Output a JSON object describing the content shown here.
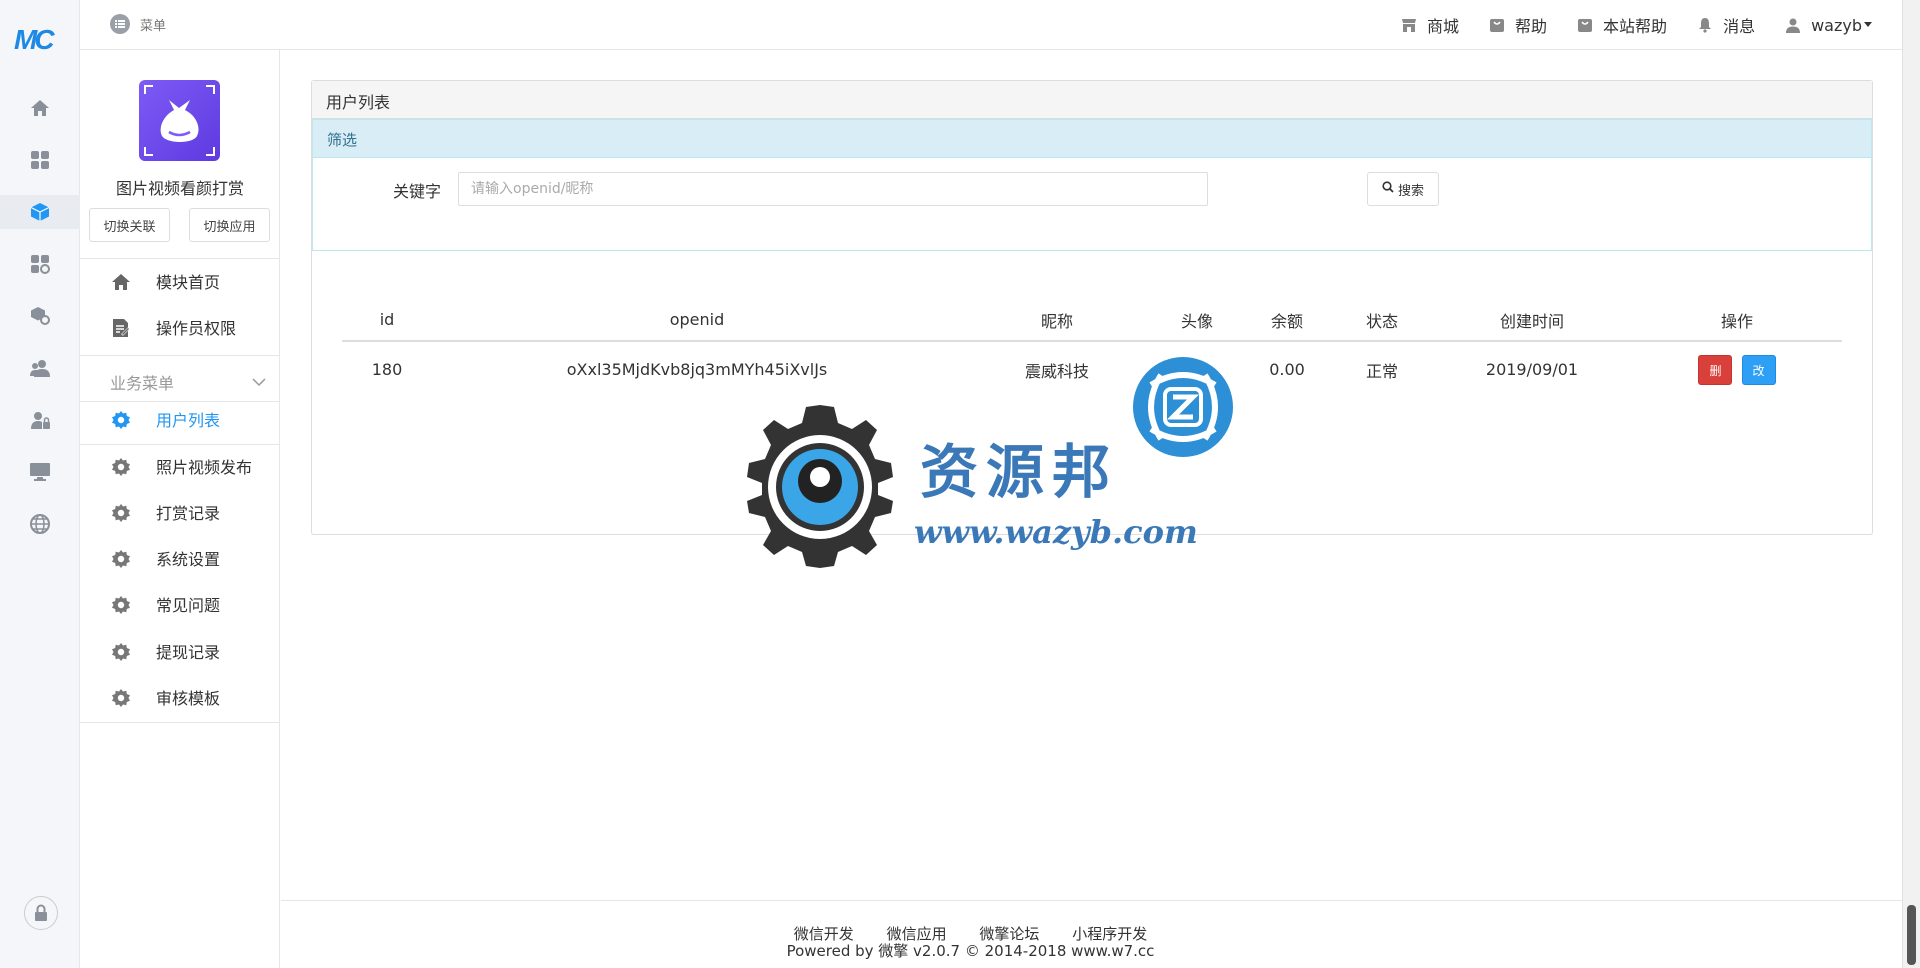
{
  "rail": {
    "logo": "MC",
    "items": [
      "home-icon",
      "apps-grid-icon",
      "module-cube-icon",
      "app-settings-icon",
      "cube-settings-icon",
      "users-icon",
      "user-lock-icon",
      "monitor-icon",
      "globe-icon"
    ],
    "active_index": 2,
    "bottom": "lock-icon"
  },
  "topbar": {
    "menu_label": "菜单",
    "nav": [
      {
        "icon": "store-icon",
        "label": "商城"
      },
      {
        "icon": "help-bag-icon",
        "label": "帮助"
      },
      {
        "icon": "site-help-icon",
        "label": "本站帮助"
      },
      {
        "icon": "bell-icon",
        "label": "消息"
      },
      {
        "icon": "user-icon",
        "label": "wazyb"
      }
    ]
  },
  "sidebar": {
    "app_name": "图片视频看颜打赏",
    "switch_link": "切换关联",
    "switch_app": "切换应用",
    "top_items": [
      {
        "icon": "home-icon",
        "label": "模块首页"
      },
      {
        "icon": "edit-doc-icon",
        "label": "操作员权限"
      }
    ],
    "group_label": "业务菜单",
    "group_items": [
      {
        "label": "用户列表",
        "active": true
      },
      {
        "label": "照片视频发布"
      },
      {
        "label": "打赏记录"
      },
      {
        "label": "系统设置"
      },
      {
        "label": "常见问题"
      },
      {
        "label": "提现记录"
      },
      {
        "label": "审核模板"
      }
    ]
  },
  "main": {
    "panel_title": "用户列表",
    "filter_title": "筛选",
    "keyword_label": "关键字",
    "keyword_placeholder": "请输入openid/昵称",
    "search_label": "搜索",
    "table": {
      "headers": [
        "id",
        "openid",
        "昵称",
        "头像",
        "余额",
        "状态",
        "创建时间",
        "操作"
      ],
      "rows": [
        {
          "id": "180",
          "openid": "oXxl35MjdKvb8jq3mMYh45iXvlJs",
          "nickname": "震威科技",
          "avatar": "",
          "balance": "0.00",
          "status": "正常",
          "created": "2019/09/01",
          "delete": "删",
          "edit": "改"
        }
      ]
    }
  },
  "watermark": {
    "text": "资源邦",
    "url": "www.wazyb.com"
  },
  "footer": {
    "links": [
      "微信开发",
      "微信应用",
      "微擎论坛",
      "小程序开发"
    ],
    "copyright": "Powered by 微擎 v2.0.7 © 2014-2018 www.w7.cc"
  },
  "colors": {
    "accent": "#2196f3",
    "danger": "#d9403a",
    "success": "#3c9a3c",
    "filter_bg": "#d9edf7"
  }
}
